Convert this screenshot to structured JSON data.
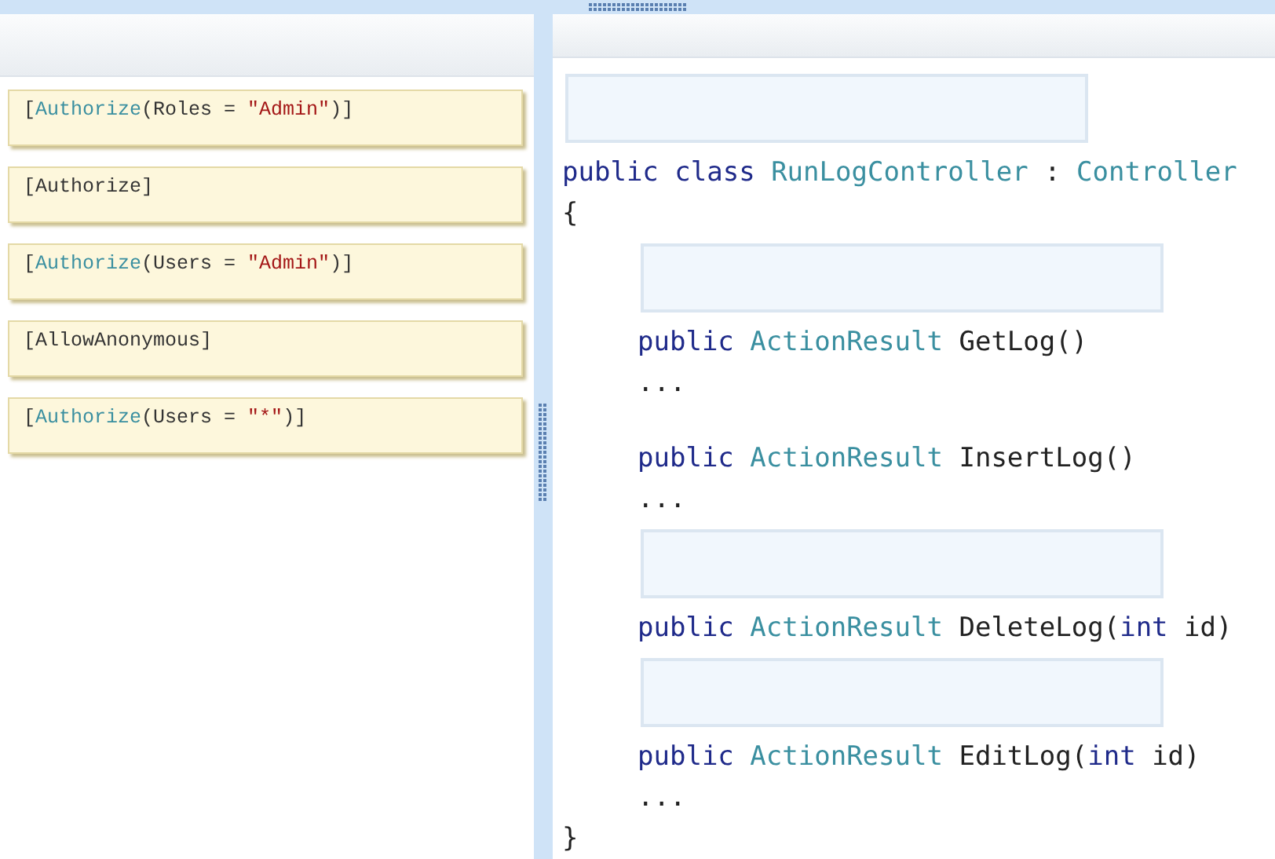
{
  "answers": [
    {
      "tokens": [
        {
          "kind": "plain",
          "text": "["
        },
        {
          "kind": "type",
          "text": "Authorize"
        },
        {
          "kind": "plain",
          "text": "(Roles = "
        },
        {
          "kind": "string",
          "text": "\"Admin\""
        },
        {
          "kind": "plain",
          "text": ")]"
        }
      ]
    },
    {
      "tokens": [
        {
          "kind": "plain",
          "text": "[Authorize]"
        }
      ]
    },
    {
      "tokens": [
        {
          "kind": "plain",
          "text": "["
        },
        {
          "kind": "type",
          "text": "Authorize"
        },
        {
          "kind": "plain",
          "text": "(Users = "
        },
        {
          "kind": "string",
          "text": "\"Admin\""
        },
        {
          "kind": "plain",
          "text": ")]"
        }
      ]
    },
    {
      "tokens": [
        {
          "kind": "plain",
          "text": "[AllowAnonymous]"
        }
      ]
    },
    {
      "tokens": [
        {
          "kind": "plain",
          "text": "["
        },
        {
          "kind": "type",
          "text": "Authorize"
        },
        {
          "kind": "plain",
          "text": "(Users = "
        },
        {
          "kind": "string",
          "text": "\"*\""
        },
        {
          "kind": "plain",
          "text": ")]"
        }
      ]
    }
  ],
  "code": {
    "class_drop_target": true,
    "header": [
      {
        "kind": "keyword",
        "text": "public class "
      },
      {
        "kind": "type",
        "text": "RunLogController"
      },
      {
        "kind": "plain",
        "text": " : "
      },
      {
        "kind": "type",
        "text": "Controller"
      }
    ],
    "open_brace": "{",
    "members": [
      {
        "drop_target": true,
        "signature": [
          {
            "kind": "keyword",
            "text": "public "
          },
          {
            "kind": "type",
            "text": "ActionResult "
          },
          {
            "kind": "plain",
            "text": "GetLog()"
          }
        ],
        "body": "..."
      },
      {
        "drop_target": false,
        "signature": [
          {
            "kind": "keyword",
            "text": "public "
          },
          {
            "kind": "type",
            "text": "ActionResult "
          },
          {
            "kind": "plain",
            "text": "InsertLog()"
          }
        ],
        "body": "..."
      },
      {
        "drop_target": true,
        "signature": [
          {
            "kind": "keyword",
            "text": "public "
          },
          {
            "kind": "type",
            "text": "ActionResult "
          },
          {
            "kind": "plain",
            "text": "DeleteLog("
          },
          {
            "kind": "keyword",
            "text": "int"
          },
          {
            "kind": "plain",
            "text": " id)"
          }
        ]
      },
      {
        "drop_target": true,
        "signature": [
          {
            "kind": "keyword",
            "text": "public "
          },
          {
            "kind": "type",
            "text": "ActionResult "
          },
          {
            "kind": "plain",
            "text": "EditLog("
          },
          {
            "kind": "keyword",
            "text": "int"
          },
          {
            "kind": "plain",
            "text": " id)"
          }
        ],
        "body": "..."
      }
    ],
    "close_brace": "}"
  }
}
